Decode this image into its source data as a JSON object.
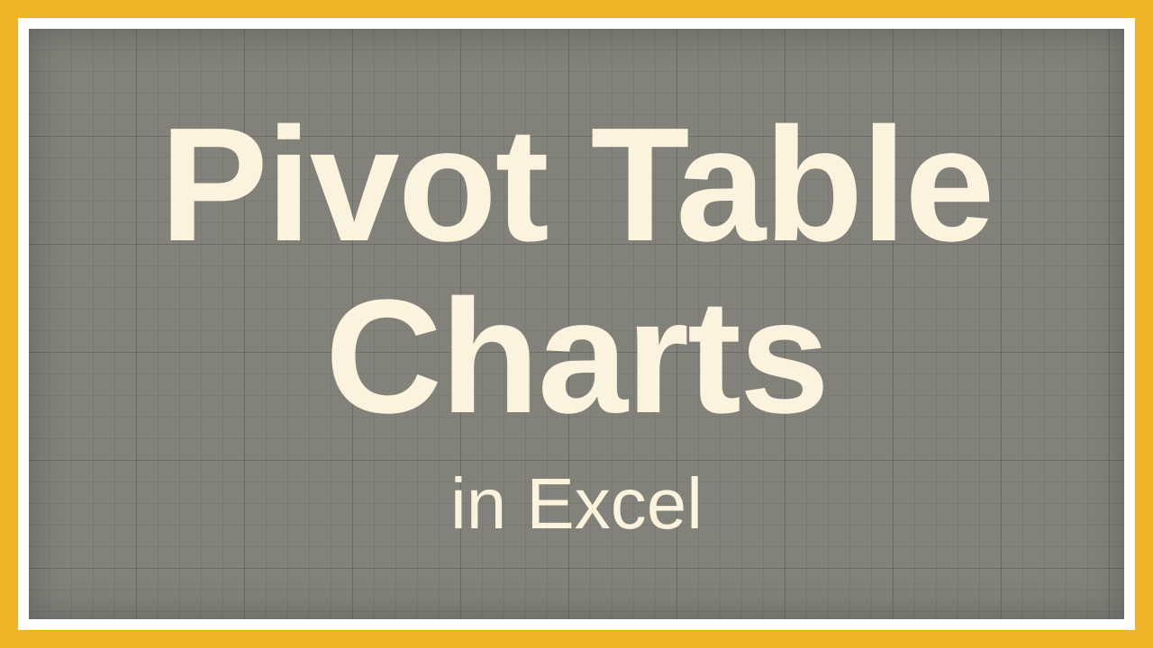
{
  "colors": {
    "outer_border": "#f0b428",
    "inner_border": "#ffffff",
    "panel_bg": "#82827b",
    "text": "#fbf3dd"
  },
  "title": {
    "line1": "Pivot Table",
    "line2": "Charts"
  },
  "subtitle": "in Excel"
}
